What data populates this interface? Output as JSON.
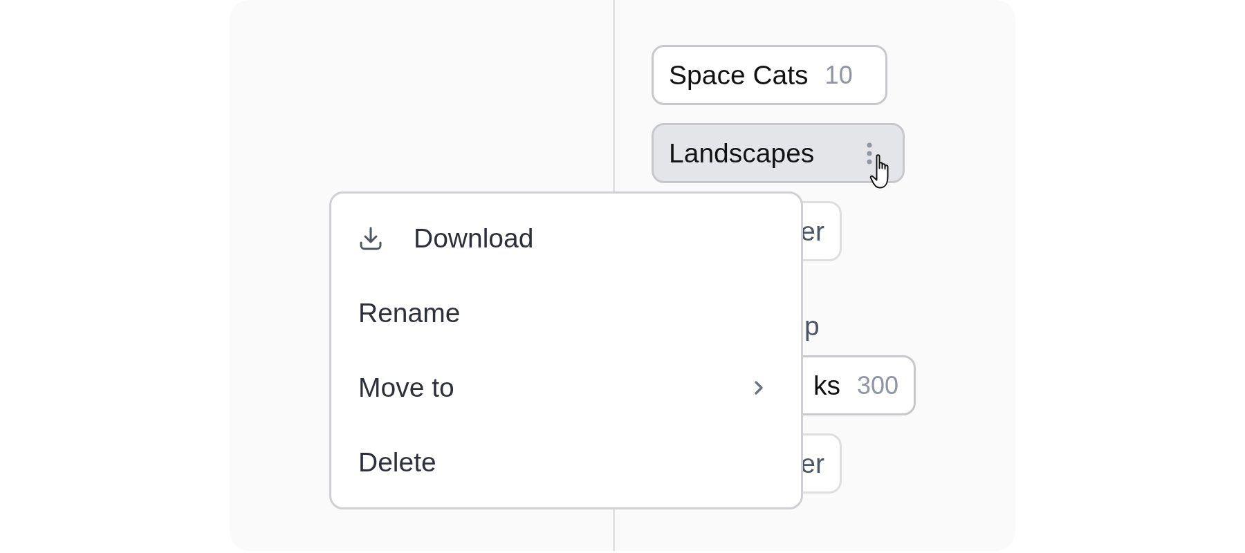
{
  "folders": [
    {
      "kind": "chip",
      "name": "Space Cats",
      "count": "10",
      "hovered": false,
      "muted": false
    },
    {
      "kind": "chip",
      "name": "Landscapes",
      "hovered": true,
      "muted": false
    },
    {
      "kind": "chip",
      "name": "er",
      "hovered": false,
      "muted": true
    },
    {
      "kind": "heading",
      "text": "p"
    },
    {
      "kind": "chip",
      "name": "ks",
      "count": "300",
      "hovered": false,
      "muted": false
    },
    {
      "kind": "chip",
      "name": "er",
      "hovered": false,
      "muted": true
    }
  ],
  "context_menu": {
    "items": [
      {
        "label": "Download",
        "submenu": false
      },
      {
        "label": "Rename",
        "submenu": false
      },
      {
        "label": "Move to",
        "submenu": true
      },
      {
        "label": "Delete",
        "submenu": false
      }
    ]
  }
}
